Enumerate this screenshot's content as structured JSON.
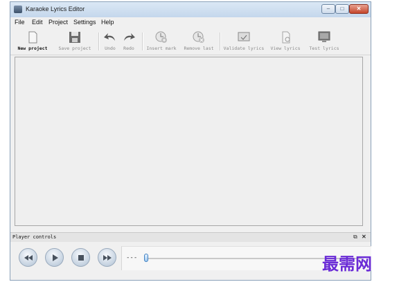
{
  "window": {
    "title": "Karaoke Lyrics Editor",
    "controls": {
      "minimize": "–",
      "maximize": "□",
      "close": "✕"
    }
  },
  "menu": [
    "File",
    "Edit",
    "Project",
    "Settings",
    "Help"
  ],
  "toolbar": {
    "items": [
      {
        "label": "New project",
        "icon": "new-document-icon",
        "enabled": true
      },
      {
        "label": "Save project",
        "icon": "save-disk-icon",
        "enabled": false
      },
      {
        "label": "Undo",
        "icon": "undo-arrow-icon",
        "enabled": false
      },
      {
        "label": "Redo",
        "icon": "redo-arrow-icon",
        "enabled": false
      },
      {
        "label": "Insert mark",
        "icon": "insert-mark-icon",
        "enabled": false
      },
      {
        "label": "Remove last",
        "icon": "remove-mark-icon",
        "enabled": false
      },
      {
        "label": "Validate lyrics",
        "icon": "validate-lyrics-icon",
        "enabled": false
      },
      {
        "label": "View lyrics",
        "icon": "view-lyrics-icon",
        "enabled": false
      },
      {
        "label": "Test lyrics",
        "icon": "test-lyrics-icon",
        "enabled": false
      }
    ]
  },
  "player": {
    "dock_title": "Player controls",
    "float_icon": "float-window-icon",
    "close_icon": "close-icon",
    "time": "---",
    "seek_fraction": 0,
    "buttons": [
      "rewind-icon",
      "play-icon",
      "stop-icon",
      "fast-forward-icon"
    ]
  },
  "watermark": "最需网",
  "colors": {
    "accent": "#3e7fc0",
    "watermark": "#6a2bd6"
  }
}
